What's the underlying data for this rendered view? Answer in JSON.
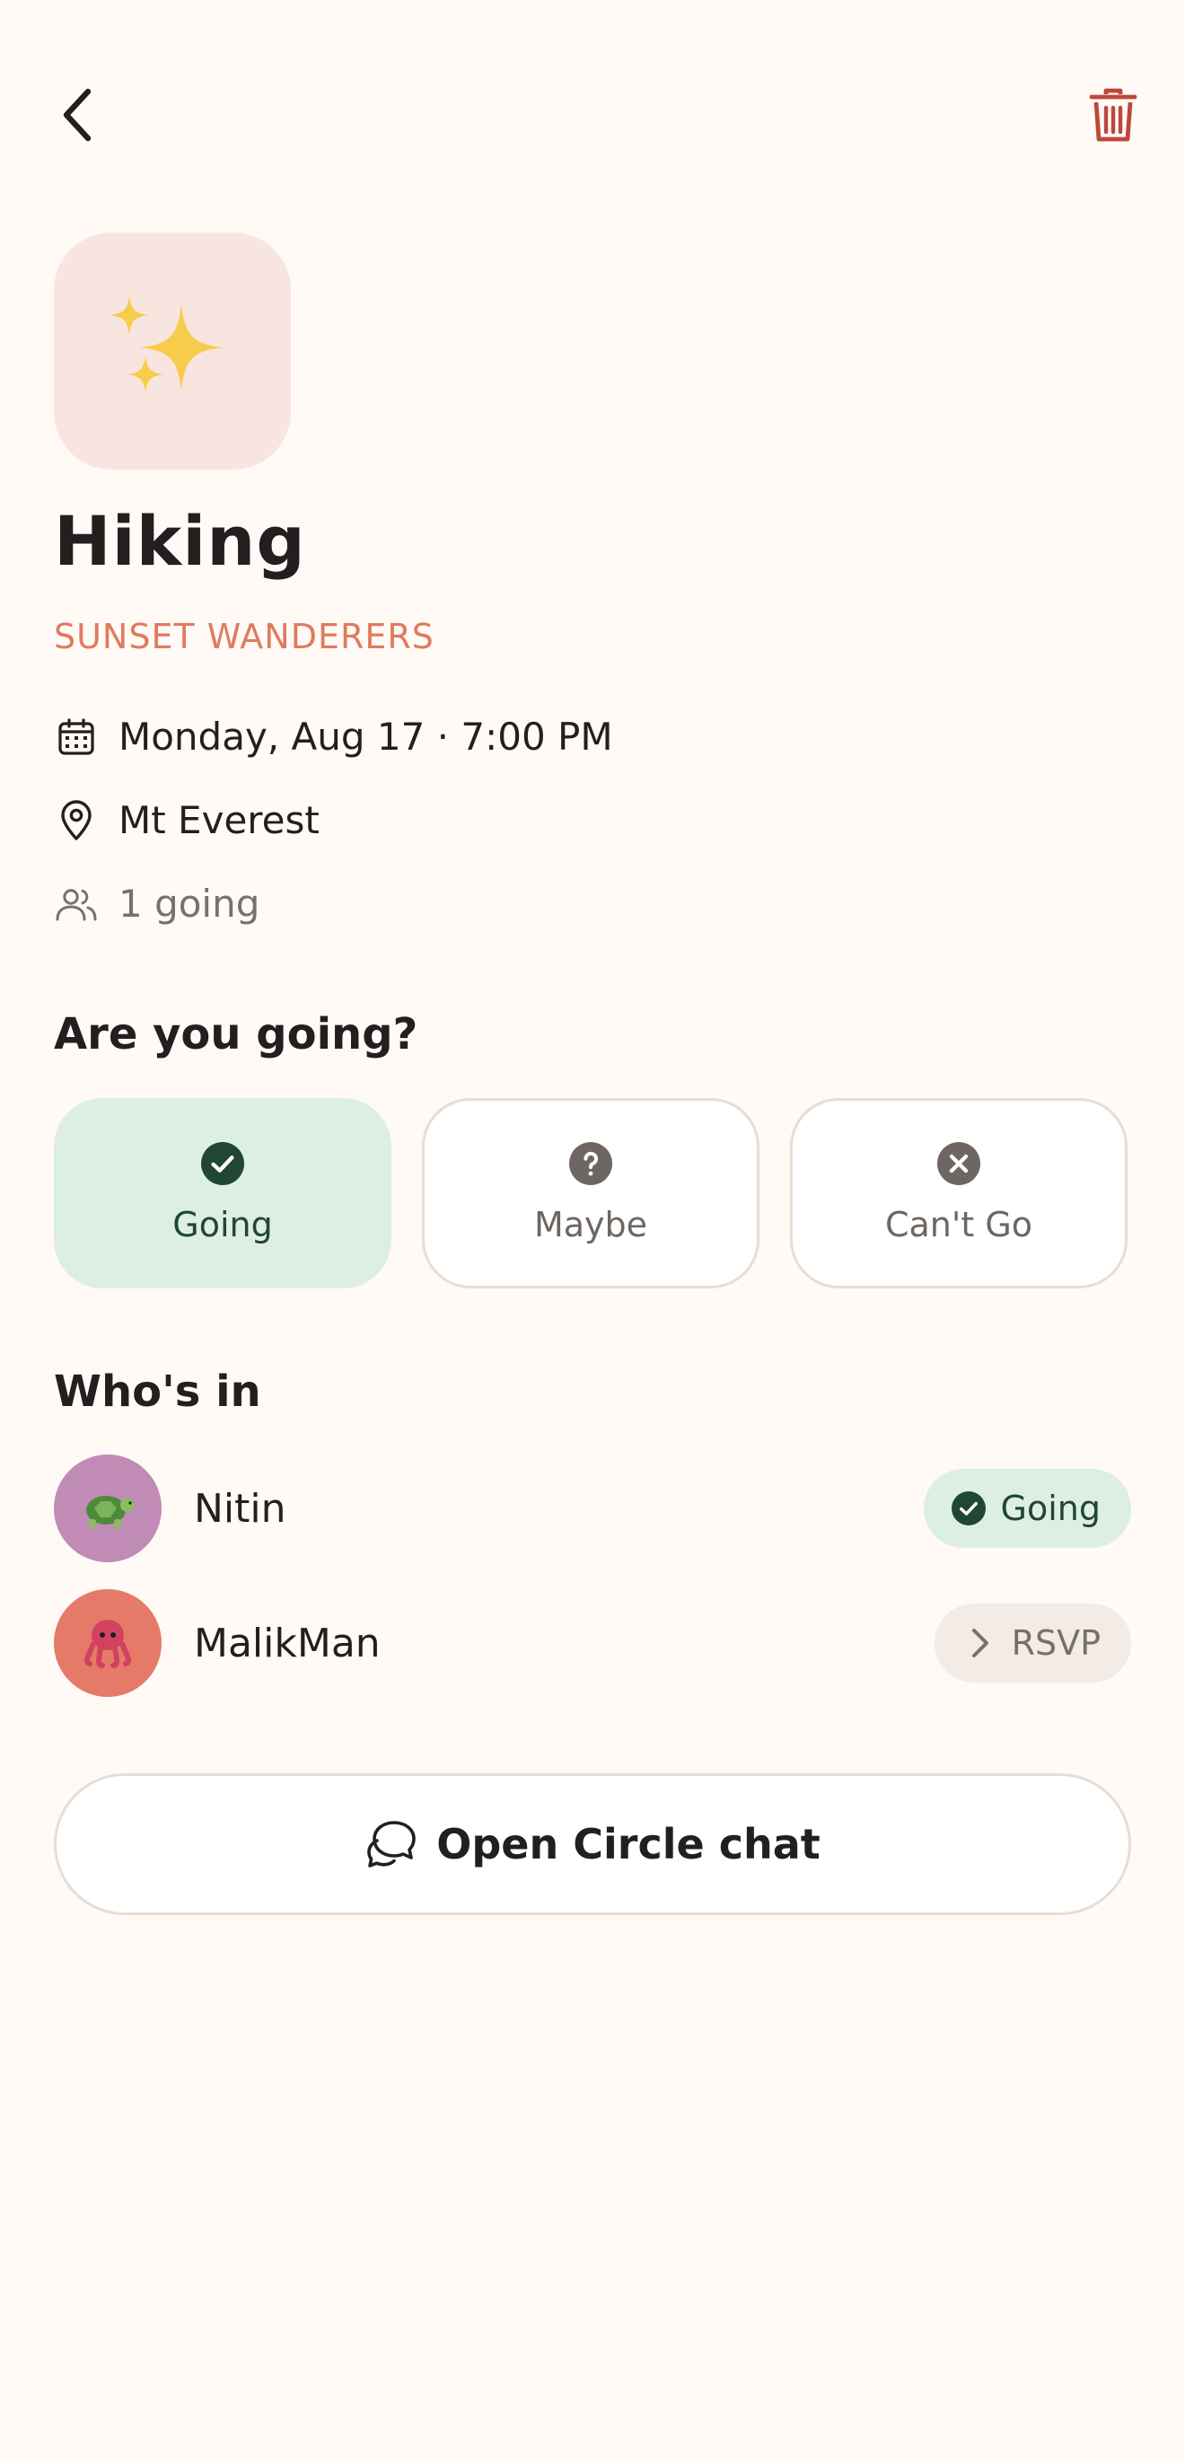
{
  "header": {
    "back_icon": "chevron-left-icon",
    "delete_icon": "trash-icon",
    "delete_color": "#C0463C"
  },
  "event": {
    "emoji": "✨",
    "title": "Hiking",
    "circle": "SUNSET WANDERERS",
    "date": "Monday, Aug 17 · 7:00 PM",
    "location": "Mt Everest",
    "going_count": "1 going"
  },
  "rsvp": {
    "heading": "Are you going?",
    "options": [
      {
        "label": "Going",
        "icon": "check-circle-icon",
        "selected": true
      },
      {
        "label": "Maybe",
        "icon": "question-circle-icon",
        "selected": false
      },
      {
        "label": "Can't Go",
        "icon": "x-circle-icon",
        "selected": false
      }
    ]
  },
  "members": {
    "heading": "Who's in",
    "list": [
      {
        "name": "Nitin",
        "avatar": "🐢",
        "avatar_color": "#C08BB5",
        "status": "Going",
        "status_icon": "check-circle-icon"
      },
      {
        "name": "MalikMan",
        "avatar": "🐙",
        "avatar_color": "#E57A68",
        "status": "RSVP",
        "status_icon": "chevron-right-icon"
      }
    ]
  },
  "chat": {
    "label": "Open Circle chat",
    "icon": "chat-bubbles-icon"
  },
  "colors": {
    "accent": "#E07A5F",
    "going_bg": "#DDEFE4",
    "going_fg": "#214634",
    "background": "#FFFAF5"
  }
}
